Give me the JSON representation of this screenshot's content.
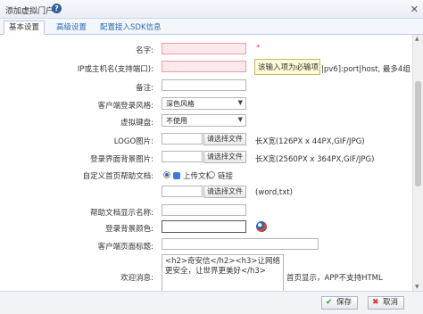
{
  "window": {
    "title": "添加虚拟门户",
    "help_icon": "?",
    "close_icon": "✕"
  },
  "tabs": [
    {
      "label": "基本设置",
      "active": true
    },
    {
      "label": "高级设置",
      "active": false
    },
    {
      "label": "配置接入SDK信息",
      "active": false
    }
  ],
  "fields": {
    "name": {
      "label": "名字:",
      "value": "",
      "required_mark": "*"
    },
    "ip": {
      "label": "IP或主机名(支持端口):",
      "value": "",
      "hint": "|pv6]:port|host, 最多4组"
    },
    "tooltip": "该输入项为必输项",
    "remark": {
      "label": "备注:",
      "value": ""
    },
    "client_style": {
      "label": "客户端登录风格:",
      "value": "深色风格"
    },
    "virtual_keyboard": {
      "label": "虚拟键盘:",
      "value": "不使用"
    },
    "logo": {
      "label": "LOGO图片:",
      "browse": "请选择文件",
      "hint": "长X宽(126PX x 44PX,GIF/JPG)"
    },
    "login_bg": {
      "label": "登录界面背景图片:",
      "browse": "请选择文件",
      "hint": "长X宽(2560PX x 364PX,GIF/JPG)"
    },
    "help_doc": {
      "label": "自定义首页帮助文档:",
      "option_upload": "上传文档",
      "option_link": "链接",
      "browse": "请选择文件",
      "hint": "(word,txt)"
    },
    "help_doc_name": {
      "label": "帮助文档显示名称:",
      "value": ""
    },
    "login_bg_color": {
      "label": "登录背景颜色:"
    },
    "client_title": {
      "label": "客户端页面标题:",
      "value": ""
    },
    "welcome": {
      "label": "欢迎消息:",
      "value": "<h2>奇安信</h2><h3>让网络更安全，让世界更美好</h3>",
      "hint": "首页显示，APP不支持HTML"
    }
  },
  "footer": {
    "save": "保存",
    "cancel": "取消"
  },
  "colors": {
    "accent": "#2a6ab5",
    "error_bg": "#fde9ec",
    "tooltip_bg": "#fffbd6"
  }
}
